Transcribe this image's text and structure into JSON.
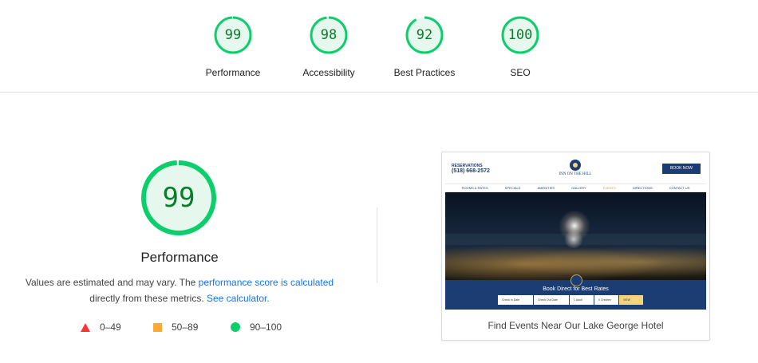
{
  "scores": [
    {
      "label": "Performance",
      "value": "99"
    },
    {
      "label": "Accessibility",
      "value": "98"
    },
    {
      "label": "Best Practices",
      "value": "92"
    },
    {
      "label": "SEO",
      "value": "100"
    }
  ],
  "main": {
    "score": "99",
    "title": "Performance",
    "desc_part1": "Values are estimated and may vary. The ",
    "desc_link1": "performance score is calculated",
    "desc_part2": "directly from these metrics. ",
    "desc_link2": "See calculator.",
    "legend": [
      {
        "range": "0–49",
        "color": "#ff3333",
        "icon": "triangle-icon"
      },
      {
        "range": "50–89",
        "color": "#ffaa33",
        "icon": "square-icon"
      },
      {
        "range": "90–100",
        "color": "#0cce6b",
        "icon": "circle-icon"
      }
    ]
  },
  "screenshot": {
    "reservations_label": "RESERVATIONS",
    "phone": "(518) 668-2572",
    "logo_text": "INN ON THE HILL",
    "book_button": "BOOK NOW",
    "nav": [
      "ROOMS & RATES",
      "SPECIALS",
      "AMENITIES",
      "GALLERY",
      "EVENTS",
      "DIRECTIONS",
      "CONTACT US"
    ],
    "nav_active": "EVENTS",
    "band_title": "Book Direct for Best Rates",
    "form": [
      "Check In Date",
      "Check Out Date",
      "1 Adult",
      "0 Children",
      "VIEW RATES"
    ],
    "caption": "Find Events Near Our Lake George Hotel"
  },
  "colors": {
    "pass_green": "#0cce6b",
    "pass_text": "#0a7d2c",
    "link": "#1a73e8",
    "site_navy": "#1c3d73"
  }
}
